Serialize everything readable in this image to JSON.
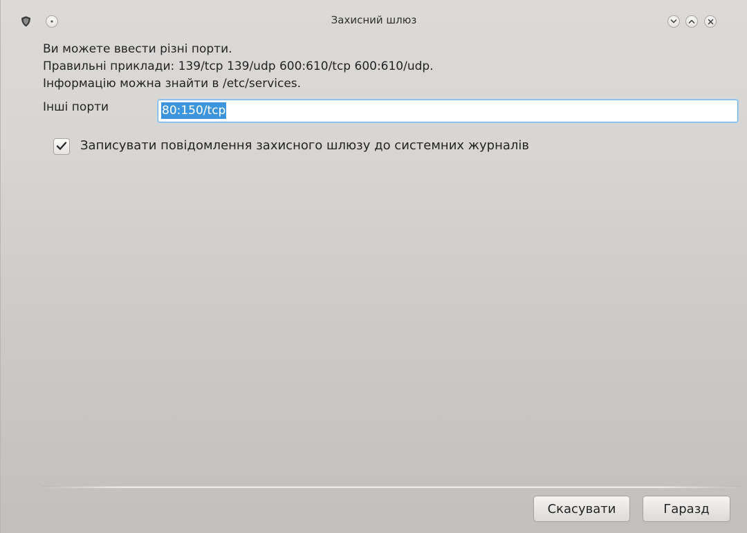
{
  "window": {
    "title": "Захисний шлюз"
  },
  "icons": {
    "app": "shield-icon",
    "menu": "dot-icon",
    "minimize": "chevron-down-icon",
    "maximize": "chevron-up-icon",
    "close": "close-icon",
    "check": "checkmark-icon"
  },
  "info": {
    "line1": "Ви можете ввести різні порти.",
    "line2": "Правильні приклади: 139/tcp 139/udp 600:610/tcp 600:610/udp.",
    "line3": "Інформацію можна знайти в /etc/services."
  },
  "ports": {
    "label": "Інші порти",
    "value": "80:150/tcp"
  },
  "logging": {
    "checked": true,
    "label": "Записувати повідомлення захисного шлюзу до системних журналів"
  },
  "buttons": {
    "cancel": "Скасувати",
    "ok": "Гаразд"
  },
  "colors": {
    "selection": "#3d95dd",
    "focus_border": "#6aaee4"
  }
}
